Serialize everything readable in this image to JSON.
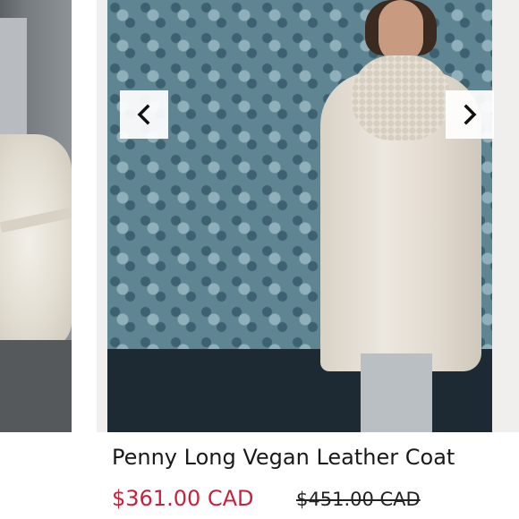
{
  "product": {
    "title": "Penny Long Vegan Leather Coat",
    "price_current": "$361.00 CAD",
    "price_original": "$451.00 CAD"
  },
  "carousel": {
    "prev_icon": "chevron-left-icon",
    "next_icon": "chevron-right-icon"
  },
  "colors": {
    "sale_price": "#cc1f3a",
    "text": "#1a1a1a",
    "nav_button_bg": "#ffffff"
  }
}
